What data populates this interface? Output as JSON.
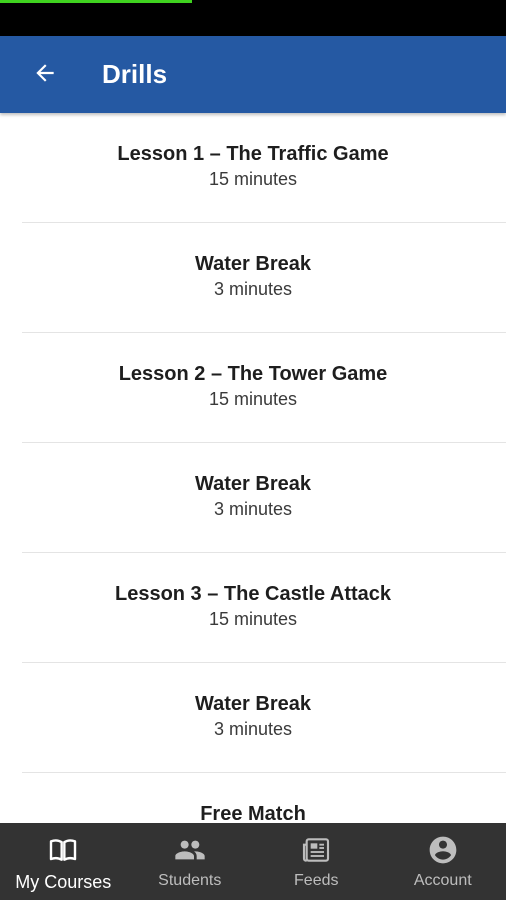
{
  "status_bar": {
    "progress": 0.38,
    "progress_color": "#3fd21f"
  },
  "app_bar": {
    "title": "Drills",
    "back_icon": "arrow-left-icon",
    "background": "#2559a3"
  },
  "drills": [
    {
      "title": "Lesson 1 – The Traffic Game",
      "duration": "15 minutes"
    },
    {
      "title": "Water Break",
      "duration": "3 minutes"
    },
    {
      "title": "Lesson 2 – The Tower Game",
      "duration": "15 minutes"
    },
    {
      "title": "Water Break",
      "duration": "3 minutes"
    },
    {
      "title": "Lesson 3 – The Castle Attack",
      "duration": "15 minutes"
    },
    {
      "title": "Water Break",
      "duration": "3 minutes"
    },
    {
      "title": "Free Match",
      "duration": ""
    }
  ],
  "bottom_nav": {
    "items": [
      {
        "label": "My Courses",
        "icon": "book-icon",
        "active": true
      },
      {
        "label": "Students",
        "icon": "people-icon",
        "active": false
      },
      {
        "label": "Feeds",
        "icon": "newspaper-icon",
        "active": false
      },
      {
        "label": "Account",
        "icon": "account-circle-icon",
        "active": false
      }
    ]
  }
}
